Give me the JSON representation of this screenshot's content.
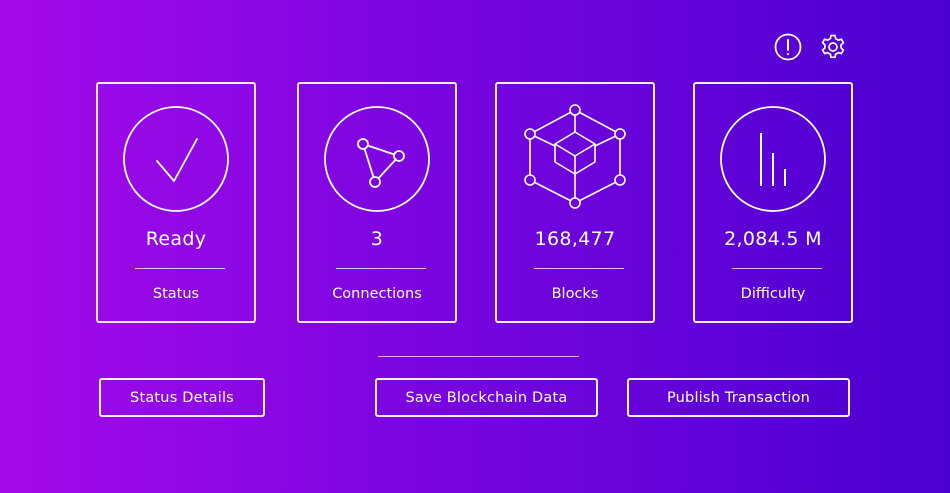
{
  "header": {
    "info_icon": "info-icon",
    "settings_icon": "gear-icon"
  },
  "cards": {
    "status": {
      "value": "Ready",
      "label": "Status",
      "icon": "checkmark-icon"
    },
    "connections": {
      "value": "3",
      "label": "Connections",
      "icon": "network-icon"
    },
    "blocks": {
      "value": "168,477",
      "label": "Blocks",
      "icon": "blockchain-cube-icon"
    },
    "difficulty": {
      "value": "2,084.5 M",
      "label": "Difficulty",
      "icon": "bar-chart-icon"
    }
  },
  "buttons": {
    "status_details": "Status Details",
    "save_blockchain": "Save Blockchain Data",
    "publish_transaction": "Publish Transaction"
  },
  "colors": {
    "gradient_start": "#a40ae9",
    "gradient_end": "#4a00d0",
    "foreground": "#ffffff"
  }
}
